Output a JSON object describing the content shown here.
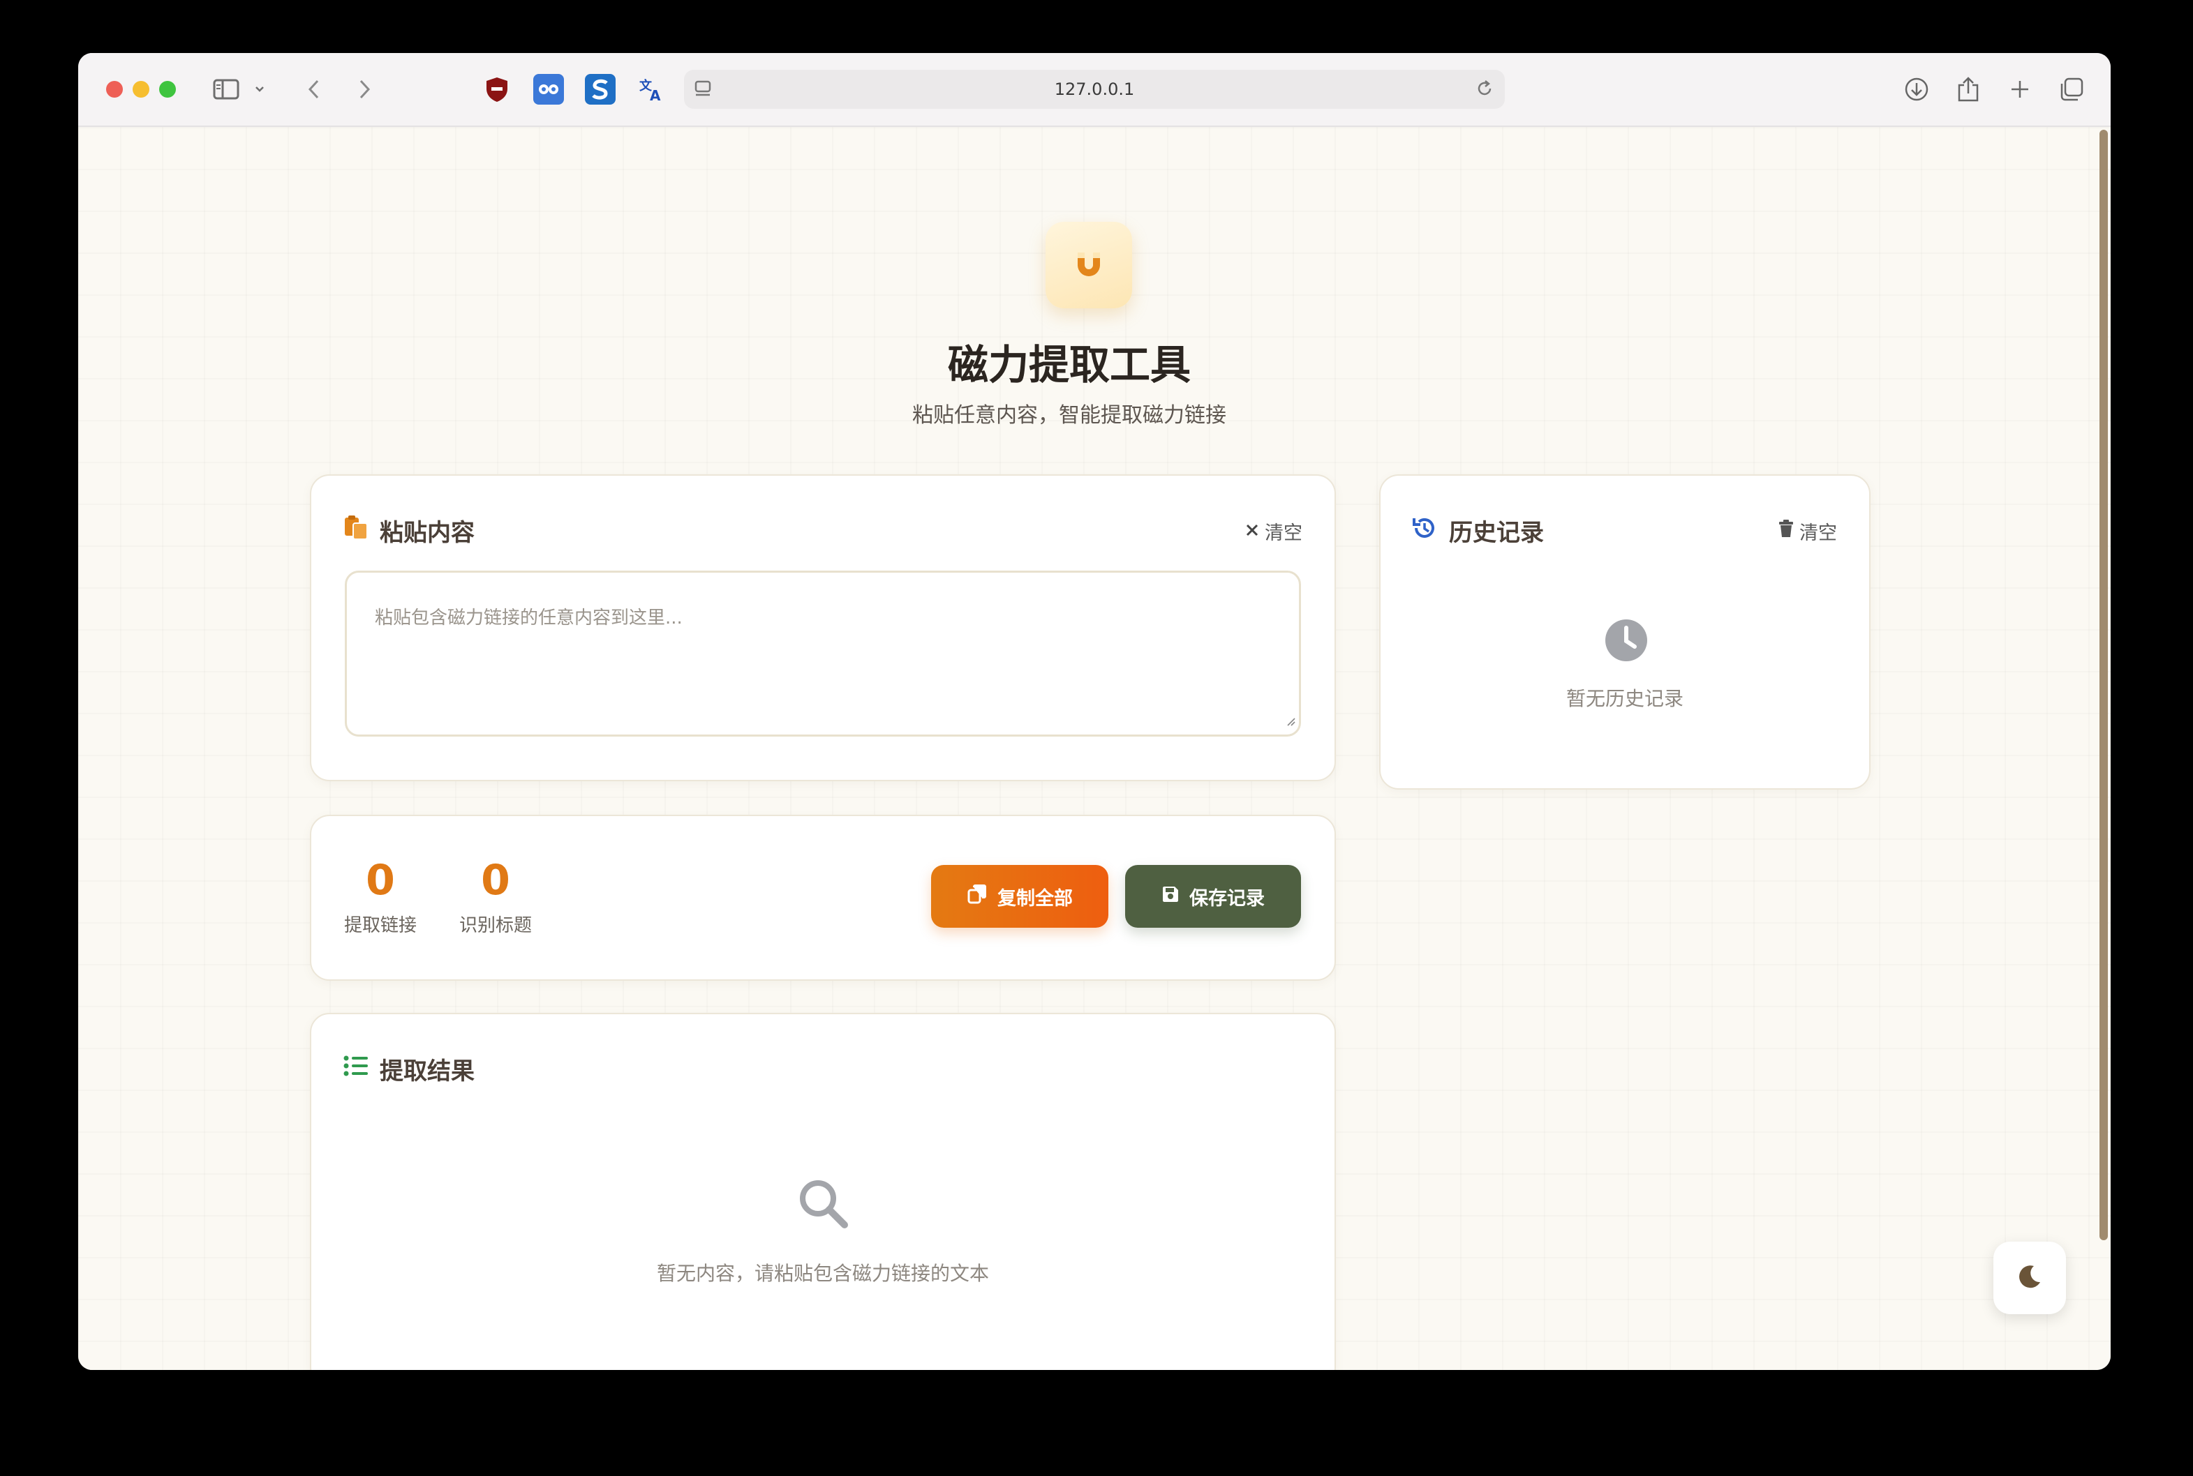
{
  "browser": {
    "url": "127.0.0.1"
  },
  "app": {
    "title": "磁力提取工具",
    "subtitle": "粘贴任意内容，智能提取磁力链接"
  },
  "paste_card": {
    "title": "粘贴内容",
    "clear_label": "清空",
    "placeholder": "粘贴包含磁力链接的任意内容到这里..."
  },
  "stats": {
    "links_count": "0",
    "links_label": "提取链接",
    "titles_count": "0",
    "titles_label": "识别标题",
    "copy_all_label": "复制全部",
    "save_label": "保存记录"
  },
  "results_card": {
    "title": "提取结果",
    "empty_text": "暂无内容，请粘贴包含磁力链接的文本"
  },
  "history_card": {
    "title": "历史记录",
    "clear_label": "清空",
    "empty_text": "暂无历史记录"
  },
  "icons": {
    "logo": "magnet-icon",
    "paste": "clipboard-icon",
    "results": "list-icon",
    "history": "history-icon",
    "empty_results": "search-icon",
    "empty_history": "clock-icon",
    "theme_toggle": "moon-icon"
  },
  "colors": {
    "accent_orange": "#e07915",
    "save_green": "#4f6041",
    "history_blue": "#2f62c8"
  }
}
